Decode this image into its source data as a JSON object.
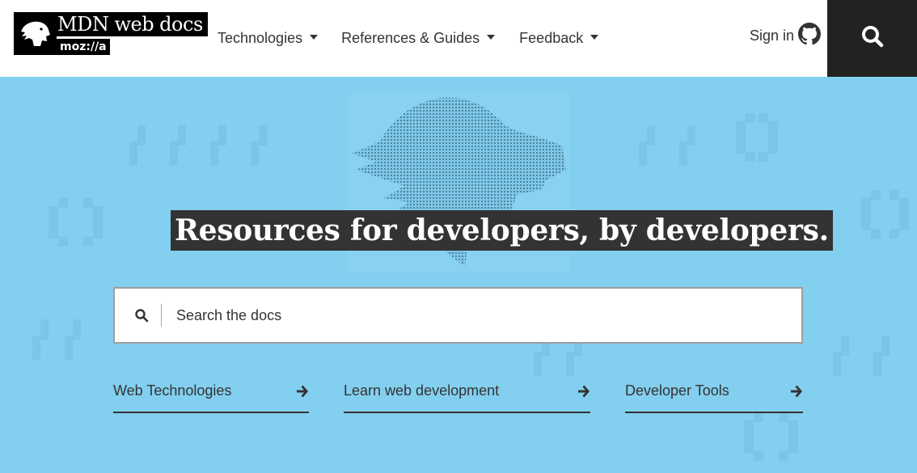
{
  "logo": {
    "title": "MDN web docs",
    "subtitle": "moz://a",
    "icon": "mdn-dino-icon"
  },
  "nav": {
    "items": [
      {
        "label": "Technologies"
      },
      {
        "label": "References & Guides"
      },
      {
        "label": "Feedback"
      }
    ]
  },
  "signin": {
    "label": "Sign in",
    "icon": "github-icon"
  },
  "header_search": {
    "icon": "search-icon"
  },
  "hero": {
    "tagline": "Resources for developers, by developers.",
    "search": {
      "placeholder": "Search the docs",
      "icon": "search-icon"
    },
    "links": [
      {
        "label": "Web Technologies",
        "icon": "arrow-right-icon"
      },
      {
        "label": "Learn web development",
        "icon": "arrow-right-icon"
      },
      {
        "label": "Developer Tools",
        "icon": "arrow-right-icon"
      }
    ]
  },
  "colors": {
    "hero_bg": "#83cfef",
    "dark": "#333333",
    "header_search_bg": "#222222"
  }
}
